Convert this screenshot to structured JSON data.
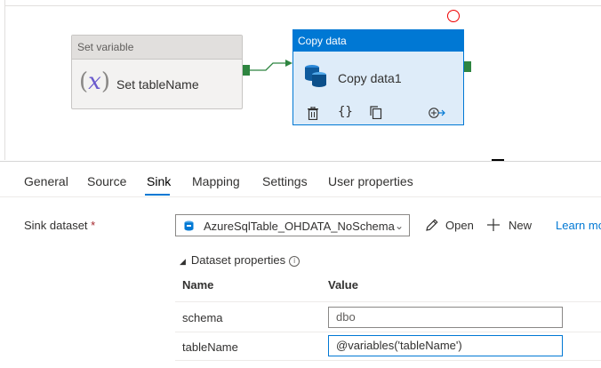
{
  "canvas": {
    "set_variable": {
      "header": "Set variable",
      "icon": "variable-icon",
      "label": "Set tableName"
    },
    "copy_data": {
      "header": "Copy data",
      "icon": "copy-data-icon",
      "label": "Copy data1",
      "tools": [
        "delete-icon",
        "code-icon",
        "clone-icon",
        "add-output-icon"
      ]
    },
    "colors": {
      "accent": "#0078d4",
      "success_port": "#2e8540",
      "error": "#e00000"
    }
  },
  "tabs": [
    "General",
    "Source",
    "Sink",
    "Mapping",
    "Settings",
    "User properties"
  ],
  "active_tab": "Sink",
  "sink": {
    "label": "Sink dataset",
    "required": "*",
    "dataset": "AzureSqlTable_OHDATA_NoSchema",
    "open_label": "Open",
    "new_label": "New",
    "learn_more": "Learn mo"
  },
  "dataset_properties": {
    "title": "Dataset properties",
    "columns": [
      "Name",
      "Value"
    ],
    "rows": [
      {
        "name": "schema",
        "value": "dbo"
      },
      {
        "name": "tableName",
        "value": "@variables('tableName')"
      }
    ]
  }
}
